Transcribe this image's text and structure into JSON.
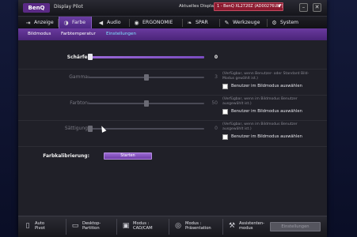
{
  "titlebar": {
    "logo": "BenQ",
    "app_title": "Display Pilot",
    "display_label": "Aktuelles Display",
    "display_value": "1 - BenQ XL2720Z (AD00276ULF)",
    "minimize": "–",
    "close": "✕"
  },
  "tabs": [
    {
      "label": "Anzeige",
      "icon": "monitor-arrow-icon"
    },
    {
      "label": "Farbe",
      "icon": "palette-icon"
    },
    {
      "label": "Audio",
      "icon": "speaker-icon"
    },
    {
      "label": "ERGONOMIE",
      "icon": "eye-icon"
    },
    {
      "label": "SPAR",
      "icon": "leaf-icon"
    },
    {
      "label": "Werkzeuge",
      "icon": "wrench-icon"
    },
    {
      "label": "System",
      "icon": "system-icon"
    }
  ],
  "subtabs": [
    {
      "label": "Bildmodus"
    },
    {
      "label": "Farbtemperatur"
    },
    {
      "label": "Einstellungen"
    }
  ],
  "settings": {
    "schaerfe": {
      "label": "Schärfe:",
      "value": "0"
    },
    "gamma": {
      "label": "Gamma:",
      "value": "3",
      "note": "(Verfügbar, wenn Benutzer- oder Standard Bild-Modus gewählt ist.)",
      "checkbox": "Benutzer im Bildmodus auswählen"
    },
    "farbton": {
      "label": "Farbton:",
      "value": "50",
      "note": "(Verfügbar, wenn im Bildmodus Benutzer ausgewählt ist.)",
      "checkbox": "Benutzer im Bildmodus auswählen"
    },
    "saettigung": {
      "label": "Sättigung:",
      "value": "0",
      "note": "(Verfügbar, wenn im Bildmodus Benutzer ausgewählt ist.)",
      "checkbox": "Benutzer im Bildmodus auswählen"
    },
    "farbkalibrierung": {
      "label": "Farbkalibrierung:",
      "button": "Starten"
    }
  },
  "slider_levels": {
    "schaerfe": 0.0,
    "gamma": 0.5,
    "farbton": 0.5,
    "saettigung": 0.0
  },
  "bottombar": [
    {
      "label_line1": "Auto",
      "label_line2": "Pivot",
      "icon": "rotate-icon"
    },
    {
      "label_line1": "Desktop-",
      "label_line2": "Partition",
      "icon": "partition-icon"
    },
    {
      "label_line1": "Modus :",
      "label_line2": "CAD/CAM",
      "icon": "cad-icon"
    },
    {
      "label_line1": "Modus :",
      "label_line2": "Präsentation",
      "icon": "presentation-icon"
    },
    {
      "label_line1": "Assistenten-",
      "label_line2": "modus",
      "icon": "wand-icon"
    }
  ],
  "hotkey_button": "Einstellungen",
  "colors": {
    "accent": "#5b2a86",
    "active_tab": "#6b3ea3",
    "display_select": "#8b1a2f",
    "active_subtab_text": "#7fe0ff"
  }
}
